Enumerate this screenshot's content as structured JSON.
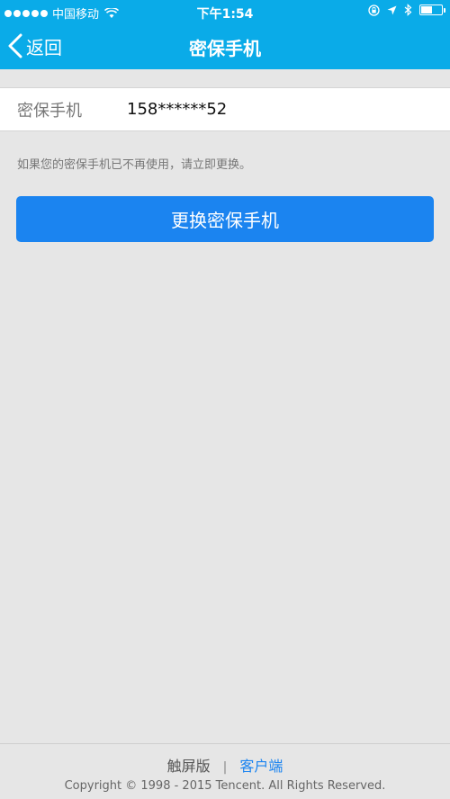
{
  "status_bar": {
    "carrier": "中国移动",
    "time": "下午1:54",
    "battery_level": 0.55
  },
  "nav": {
    "back_label": "返回",
    "title": "密保手机"
  },
  "phone": {
    "label": "密保手机",
    "value": "158******52"
  },
  "hint": "如果您的密保手机已不再使用，请立即更换。",
  "change_button": "更换密保手机",
  "footer": {
    "touch_version": "触屏版",
    "separator": "|",
    "client": "客户端",
    "copyright": "Copyright © 1998 - 2015 Tencent. All Rights Reserved."
  },
  "colors": {
    "header": "#0aabe8",
    "button": "#1b84f0",
    "background": "#e6e6e6"
  }
}
